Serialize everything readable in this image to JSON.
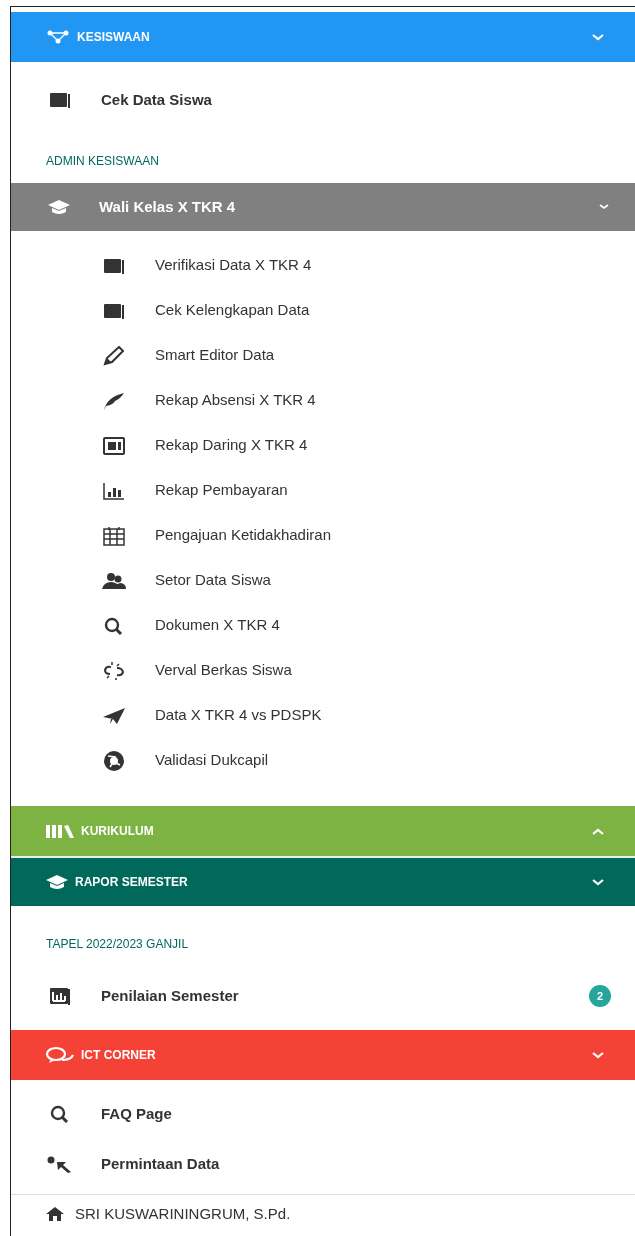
{
  "menu": [
    {
      "title": "KESISWAAN",
      "color": "#2196f3",
      "expanded": true,
      "children": [
        {
          "kind": "item",
          "label": "Cek Data Siswa"
        },
        {
          "kind": "label",
          "label": "ADMIN KESISWAAN"
        },
        {
          "kind": "submenu",
          "title": "Wali Kelas X TKR 4",
          "expanded": true,
          "children": [
            {
              "label": "Verifikasi Data X TKR 4"
            },
            {
              "label": "Cek Kelengkapan Data"
            },
            {
              "label": "Smart Editor Data"
            },
            {
              "label": "Rekap Absensi X TKR 4"
            },
            {
              "label": "Rekap Daring X TKR 4"
            },
            {
              "label": "Rekap Pembayaran"
            },
            {
              "label": "Pengajuan Ketidakhadiran"
            },
            {
              "label": "Setor Data Siswa"
            },
            {
              "label": "Dokumen X TKR 4"
            },
            {
              "label": "Verval Berkas Siswa"
            },
            {
              "label": "Data X TKR 4 vs PDSPK"
            },
            {
              "label": "Validasi Dukcapil"
            }
          ]
        }
      ]
    },
    {
      "title": "KURIKULUM",
      "color": "#7cb342",
      "expanded": false
    },
    {
      "title": "RAPOR SEMESTER",
      "color": "#00695c",
      "expanded": true,
      "children": [
        {
          "kind": "label",
          "label": "TAPEL 2022/2023 GANJIL"
        },
        {
          "kind": "item",
          "label": "Penilaian Semester",
          "badge": "2"
        }
      ]
    },
    {
      "title": "ICT CORNER",
      "color": "#f44336",
      "expanded": true,
      "children": [
        {
          "kind": "item",
          "label": "FAQ Page"
        },
        {
          "kind": "item",
          "label": "Permintaan Data"
        }
      ]
    }
  ],
  "footer": {
    "user": "SRI KUSWARININGRUM, S.Pd."
  }
}
